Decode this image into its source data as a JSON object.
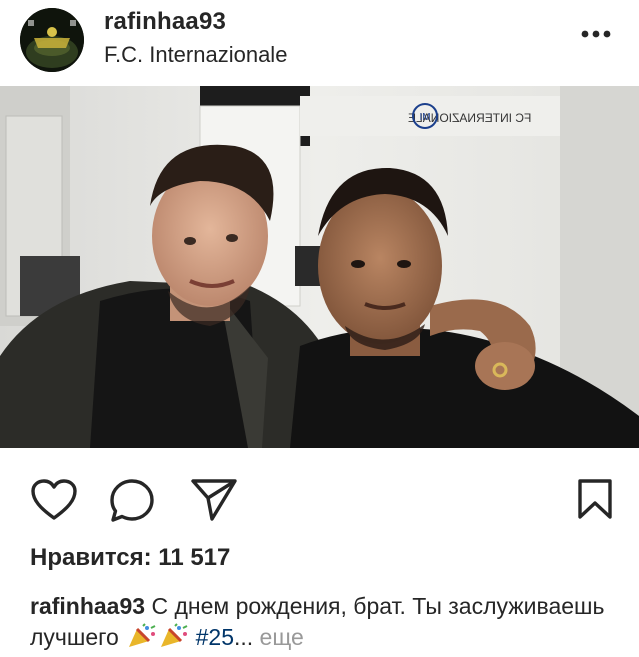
{
  "post": {
    "username": "rafinhaa93",
    "location": "F.C. Internazionale",
    "likes_text": "Нравится: 11 517",
    "caption": {
      "username": "rafinhaa93",
      "text_part1": "С днем рождения, брат. Ты заслуживаешь лучшего",
      "emoji": [
        "party-popper",
        "party-popper"
      ],
      "hashtag": "#25",
      "ellipsis": "...",
      "more_label": "еще"
    },
    "photo_wall_sign": "FC INTERNAZIONALE"
  },
  "icons": {
    "more": "more-horizontal-icon",
    "like": "heart-icon",
    "comment": "comment-bubble-icon",
    "share": "paper-plane-icon",
    "save": "bookmark-icon"
  },
  "colors": {
    "text": "#262626",
    "hashtag": "#003569",
    "muted": "#999999",
    "background": "#ffffff"
  }
}
